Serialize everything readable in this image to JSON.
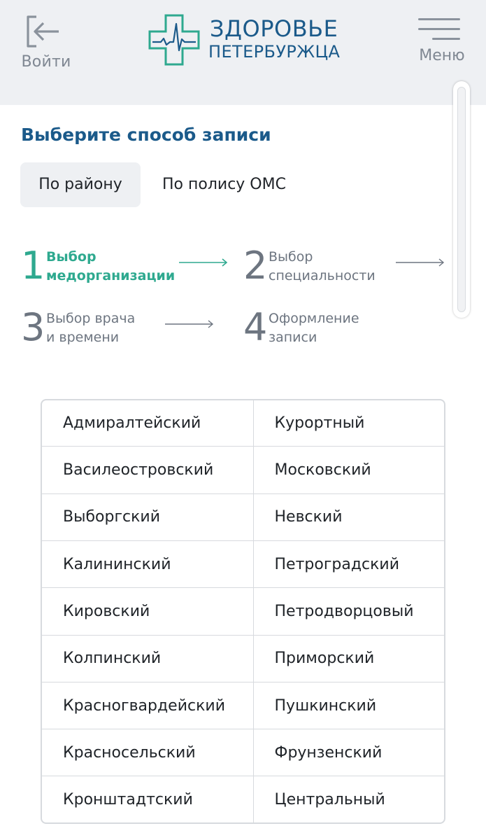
{
  "header": {
    "login_label": "Войти",
    "logo_line1": "ЗДОРОВЬЕ",
    "logo_line2": "ПЕТЕРБУРЖЦА",
    "menu_label": "Меню"
  },
  "icons": {
    "login": "login-arrow-icon",
    "logo": "medical-cross-cardiogram-icon",
    "menu": "hamburger-menu-icon",
    "arrow": "right-arrow-icon"
  },
  "colors": {
    "brand_blue": "#1b5a8a",
    "accent_green": "#2ea98f",
    "header_bg": "#eef0f3",
    "muted_gray": "#6d7580"
  },
  "page": {
    "title": "Выберите способ записи"
  },
  "tabs": [
    {
      "label": "По району",
      "active": true
    },
    {
      "label": "По полису ОМС",
      "active": false
    }
  ],
  "steps": [
    {
      "number": "1",
      "line1": "Выбор",
      "line2": "медорганизации",
      "active": true
    },
    {
      "number": "2",
      "line1": "Выбор",
      "line2": "специальности",
      "active": false
    },
    {
      "number": "3",
      "line1": "Выбор врача",
      "line2": "и времени",
      "active": false
    },
    {
      "number": "4",
      "line1": "Оформление",
      "line2": "записи",
      "active": false
    }
  ],
  "districts": [
    [
      "Адмиралтейский",
      "Курортный"
    ],
    [
      "Василеостровский",
      "Московский"
    ],
    [
      "Выборгский",
      "Невский"
    ],
    [
      "Калининский",
      "Петроградский"
    ],
    [
      "Кировский",
      "Петродворцовый"
    ],
    [
      "Колпинский",
      "Приморский"
    ],
    [
      "Красногвардейский",
      "Пушкинский"
    ],
    [
      "Красносельский",
      "Фрунзенский"
    ],
    [
      "Кронштадтский",
      "Центральный"
    ]
  ]
}
